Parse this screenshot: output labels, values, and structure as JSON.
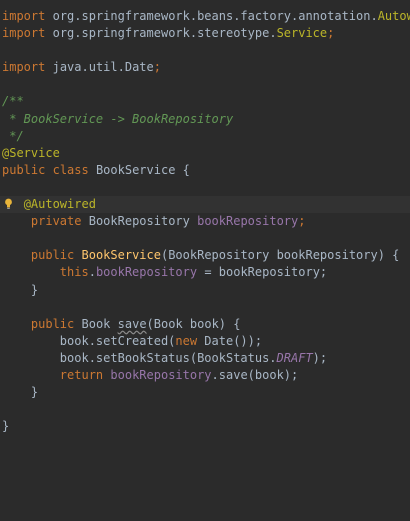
{
  "code": {
    "l1": {
      "kw": "import",
      "pkg": "org.springframework.beans.factory.annotation.",
      "ann": "Autowired",
      "end": ";"
    },
    "l2": {
      "kw": "import",
      "pkg": "org.springframework.stereotype.",
      "ann": "Service",
      "end": ";"
    },
    "l4": {
      "kw": "import",
      "pkg": "java.util.Date",
      "end": ";"
    },
    "l6": {
      "cmt": "/**"
    },
    "l7": {
      "cmt": " * BookService -> BookRepository"
    },
    "l8": {
      "cmt": " */"
    },
    "l9": {
      "ann": "@Service"
    },
    "l10": {
      "kw1": "public",
      "kw2": "class",
      "name": "BookService",
      "brace": " {"
    },
    "l12": {
      "ann": "@Autowired"
    },
    "l13": {
      "kw": "private",
      "type": "BookRepository",
      "fld": "bookRepository",
      "end": ";"
    },
    "l15": {
      "kw": "public",
      "fn": "BookService",
      "params": "(BookRepository bookRepository) {"
    },
    "l16": {
      "kw": "this",
      "dot": ".",
      "fld": "bookRepository",
      "rest": " = bookRepository;"
    },
    "l17": {
      "brace": "}"
    },
    "l19": {
      "kw": "public",
      "type": "Book",
      "method": "save",
      "params": "(Book book) {"
    },
    "l20": {
      "pre": "book.setCreated(",
      "kw": "new",
      "rest": " Date());"
    },
    "l21": {
      "pre": "book.setBookStatus(BookStatus.",
      "const": "DRAFT",
      "rest": ");"
    },
    "l22": {
      "kw": "return",
      "fld": "bookRepository",
      "rest": ".save(book);"
    },
    "l23": {
      "brace": "}"
    },
    "l25": {
      "brace": "}"
    }
  },
  "icons": {
    "gutter": "lightbulb-icon"
  },
  "colors": {
    "background": "#2b2b2b",
    "keyword": "#cc7832",
    "annotation": "#bbb529",
    "comment": "#629755",
    "field": "#9876aa",
    "method": "#ffc66d",
    "text": "#a9b7c6"
  }
}
